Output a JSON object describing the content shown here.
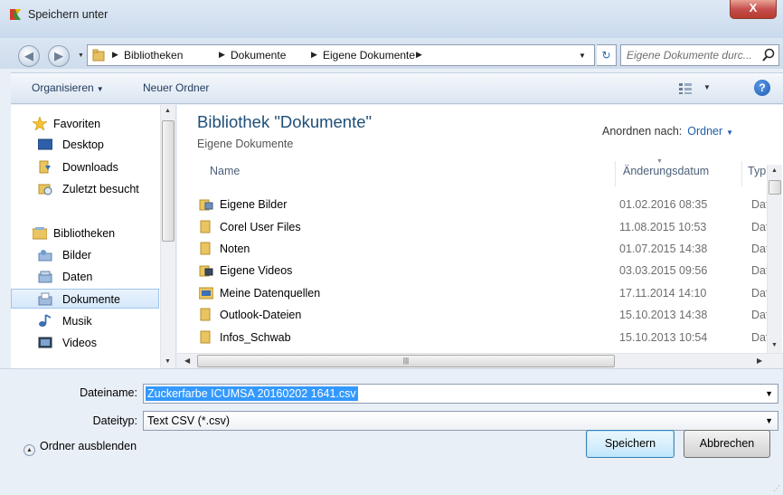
{
  "window": {
    "title": "Speichern unter",
    "close_label": "X"
  },
  "address": {
    "breadcrumbs": [
      "Bibliotheken",
      "Dokumente",
      "Eigene Dokumente"
    ],
    "search_placeholder": "Eigene Dokumente durc..."
  },
  "toolbar": {
    "organize_label": "Organisieren",
    "new_folder_label": "Neuer Ordner"
  },
  "nav": {
    "favorites_header": "Favoriten",
    "favorites": [
      "Desktop",
      "Downloads",
      "Zuletzt besucht"
    ],
    "libraries_header": "Bibliotheken",
    "libraries": [
      "Bilder",
      "Daten",
      "Dokumente",
      "Musik",
      "Videos"
    ],
    "selected": "Dokumente"
  },
  "content": {
    "library_title": "Bibliothek \"Dokumente\"",
    "library_subtitle": "Eigene Dokumente",
    "arrange_label": "Anordnen nach:",
    "arrange_value": "Ordner",
    "columns": {
      "name": "Name",
      "date": "Änderungsdatum",
      "type": "Typ"
    },
    "files": [
      {
        "name": "Eigene Bilder",
        "date": "01.02.2016 08:35",
        "type": "Dat",
        "icon": "pictures-folder-icon"
      },
      {
        "name": "Corel User Files",
        "date": "11.08.2015 10:53",
        "type": "Dat",
        "icon": "folder-icon"
      },
      {
        "name": "Noten",
        "date": "01.07.2015 14:38",
        "type": "Dat",
        "icon": "folder-icon"
      },
      {
        "name": "Eigene Videos",
        "date": "03.03.2015 09:56",
        "type": "Dat",
        "icon": "videos-folder-icon"
      },
      {
        "name": "Meine Datenquellen",
        "date": "17.11.2014 14:10",
        "type": "Dat",
        "icon": "datasource-folder-icon"
      },
      {
        "name": "Outlook-Dateien",
        "date": "15.10.2013 14:38",
        "type": "Dat",
        "icon": "folder-icon"
      },
      {
        "name": "Infos_Schwab",
        "date": "15.10.2013 10:54",
        "type": "Dat",
        "icon": "folder-icon"
      }
    ]
  },
  "form": {
    "filename_label": "Dateiname:",
    "filename_value": "Zuckerfarbe ICUMSA 20160202 1641.csv",
    "filetype_label": "Dateityp:",
    "filetype_value": "Text CSV (*.csv)"
  },
  "footer": {
    "hide_folders_label": "Ordner ausblenden",
    "save_label": "Speichern",
    "cancel_label": "Abbrechen"
  },
  "colors": {
    "accent": "#1e4e79",
    "selection": "#3399ff",
    "close": "#c75050"
  }
}
